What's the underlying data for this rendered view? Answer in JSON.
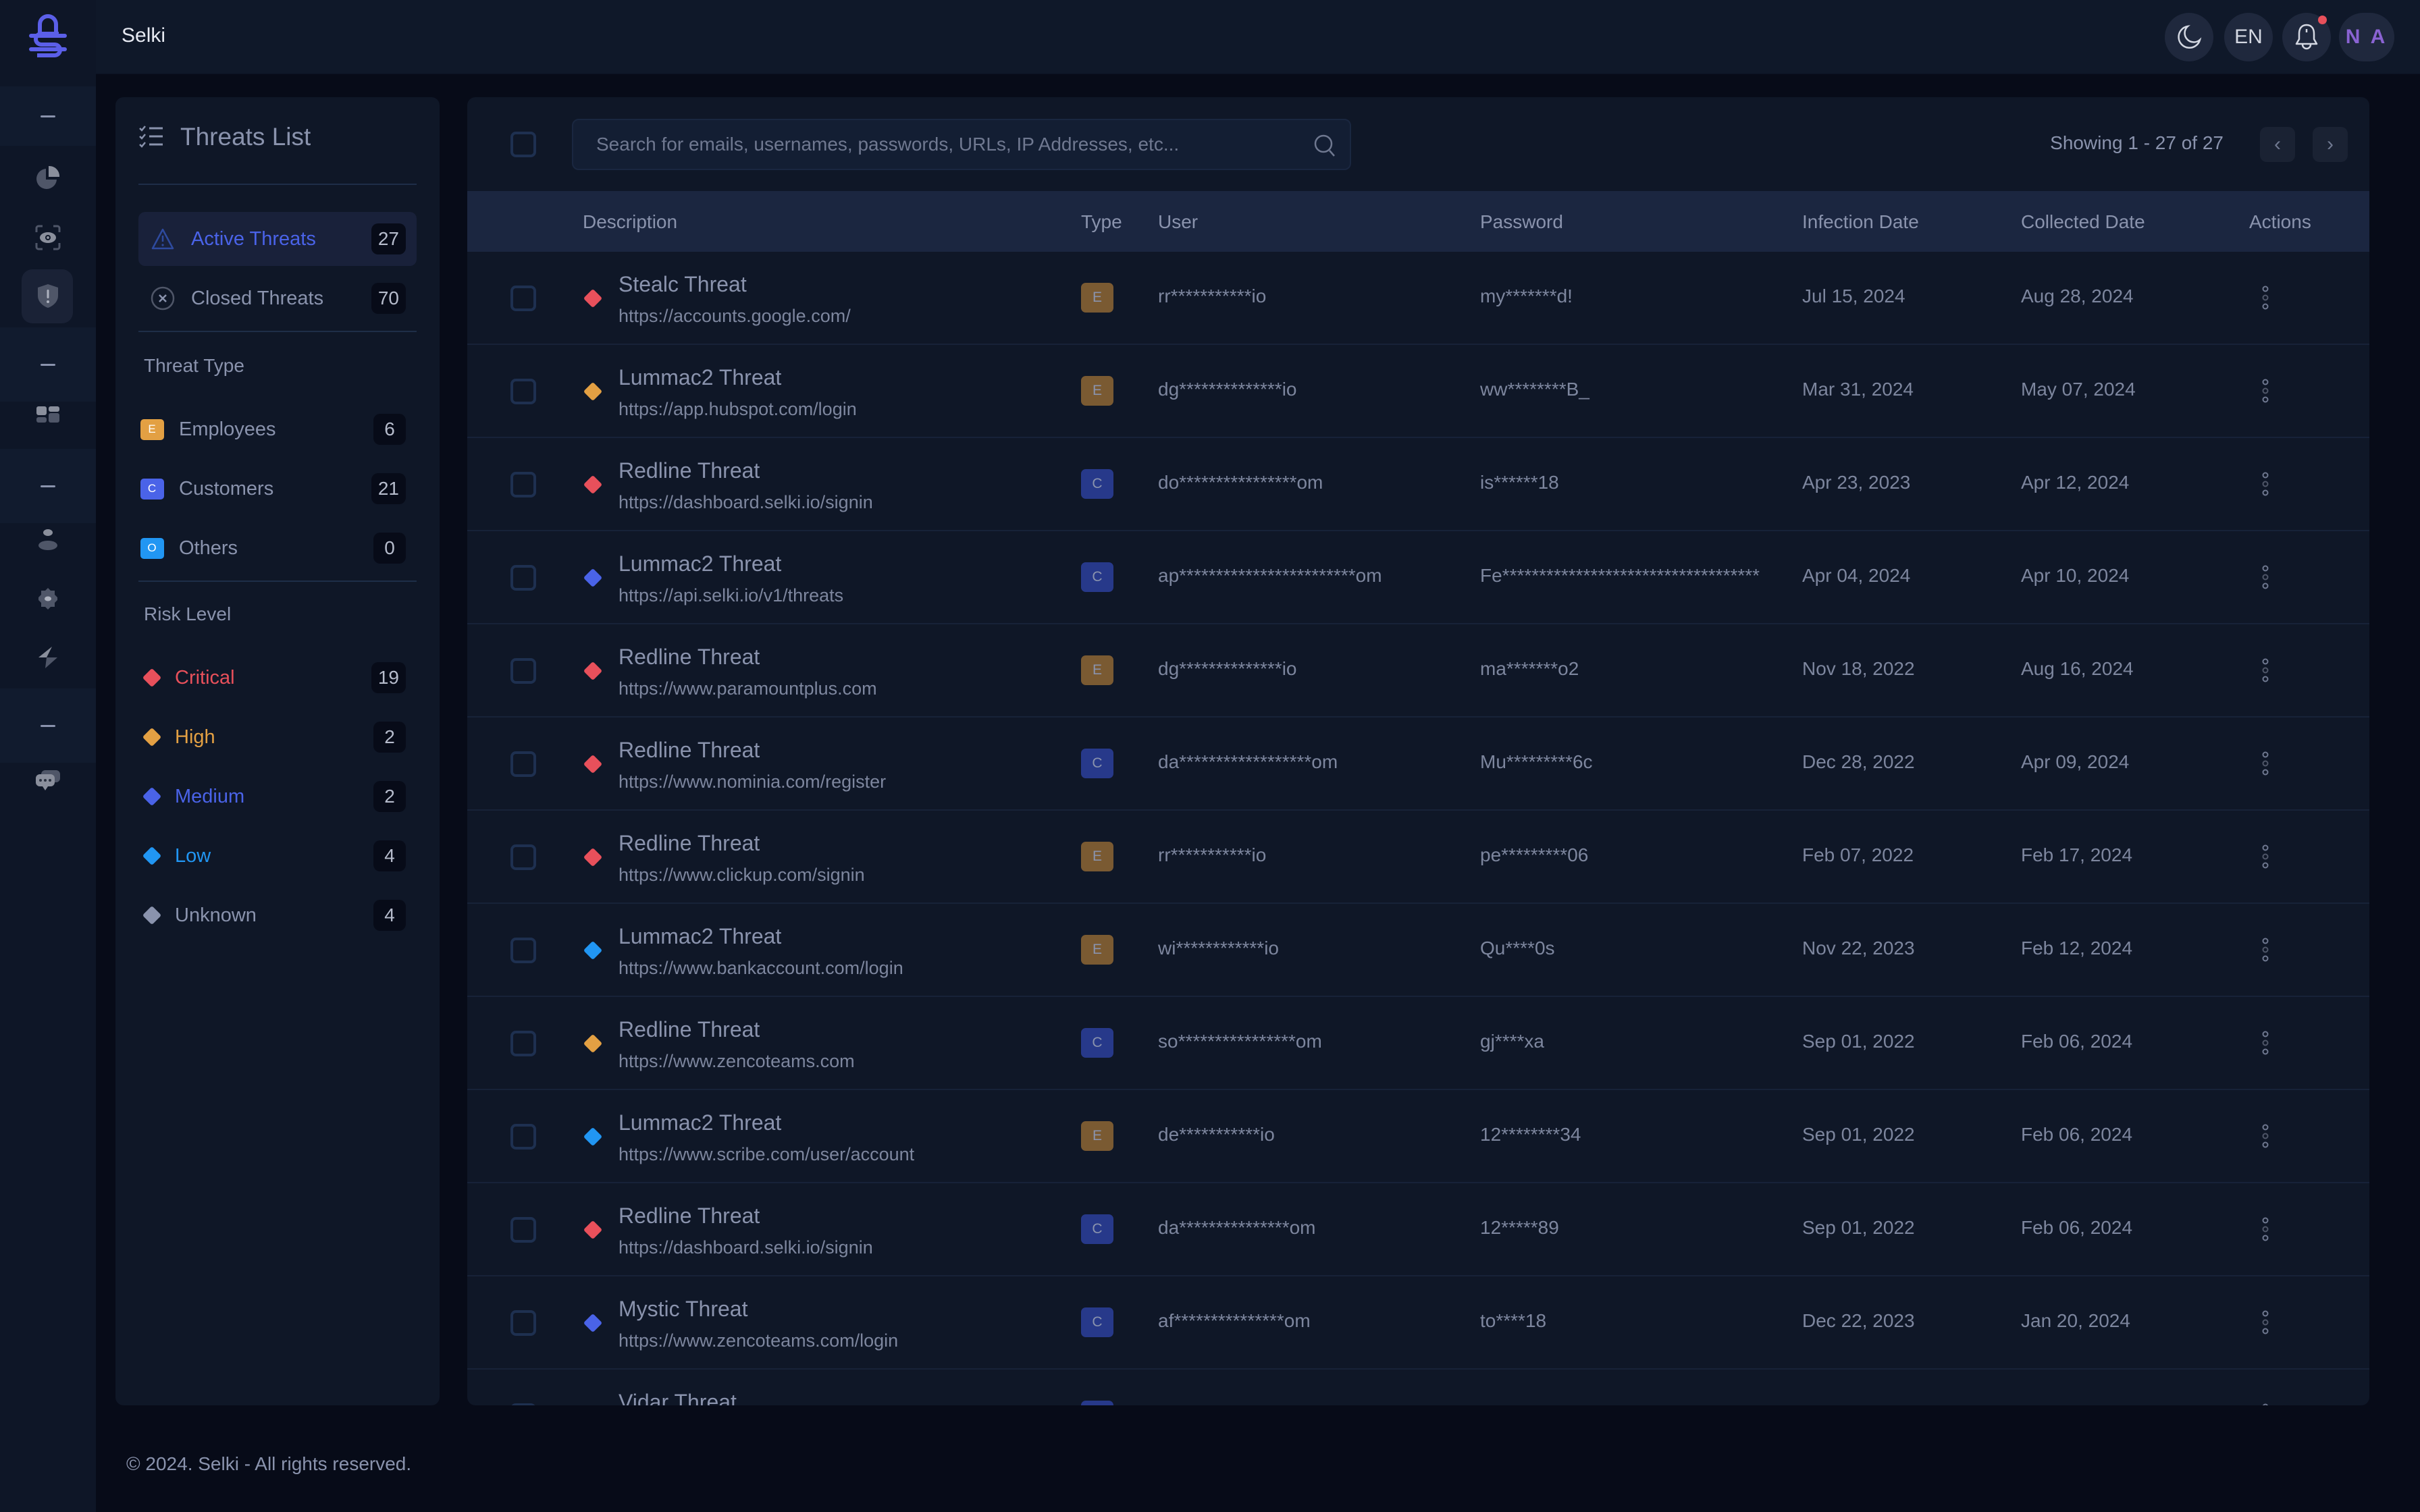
{
  "app": {
    "title": "Selki"
  },
  "header": {
    "theme_icon": "moon-icon",
    "language": "EN",
    "notification_icon": "bell-icon",
    "avatar_initials": "N A",
    "notification_dot_color": "#e8505b"
  },
  "rail": {
    "items": [
      {
        "name": "collapse",
        "icon": "dash-icon"
      },
      {
        "name": "dashboard",
        "icon": "pie-chart-icon"
      },
      {
        "name": "monitoring",
        "icon": "eye-scan-icon"
      },
      {
        "name": "threats",
        "icon": "shield-alert-icon",
        "active": true
      },
      {
        "name": "separator-1",
        "icon": "dash-icon"
      },
      {
        "name": "apps",
        "icon": "grid-icon"
      },
      {
        "name": "separator-2",
        "icon": "dash-icon"
      },
      {
        "name": "users",
        "icon": "user-icon"
      },
      {
        "name": "settings",
        "icon": "gear-icon"
      },
      {
        "name": "integrations",
        "icon": "bolt-icon"
      },
      {
        "name": "separator-3",
        "icon": "dash-icon"
      },
      {
        "name": "support",
        "icon": "chat-icon"
      }
    ]
  },
  "threats_panel": {
    "title": "Threats List",
    "status": [
      {
        "label": "Active Threats",
        "count": "27",
        "active": true,
        "color": "#4a63e8"
      },
      {
        "label": "Closed Threats",
        "count": "70",
        "active": false
      }
    ],
    "threat_type_heading": "Threat Type",
    "types": [
      {
        "letter": "E",
        "label": "Employees",
        "count": "6",
        "color": "#e3a043"
      },
      {
        "letter": "C",
        "label": "Customers",
        "count": "21",
        "color": "#4a63e8"
      },
      {
        "letter": "O",
        "label": "Others",
        "count": "0",
        "color": "#2196f3"
      }
    ],
    "risk_heading": "Risk Level",
    "risks": [
      {
        "label": "Critical",
        "count": "19",
        "color": "#e8505b"
      },
      {
        "label": "High",
        "count": "2",
        "color": "#e3a043"
      },
      {
        "label": "Medium",
        "count": "2",
        "color": "#4a63e8"
      },
      {
        "label": "Low",
        "count": "4",
        "color": "#2196f3"
      },
      {
        "label": "Unknown",
        "count": "4",
        "color": "#8a93ad"
      }
    ]
  },
  "table": {
    "search_placeholder": "Search for emails, usernames, passwords, URLs, IP Addresses, etc...",
    "showing": "Showing 1 - 27 of 27",
    "columns": [
      "Description",
      "Type",
      "User",
      "Password",
      "Infection Date",
      "Collected Date",
      "Actions"
    ],
    "type_colors": {
      "E": "#7a5a32",
      "C": "#27398a"
    },
    "risk_colors": {
      "critical": "#e8505b",
      "high": "#e3a043",
      "medium": "#4a63e8",
      "low": "#2196f3"
    },
    "rows": [
      {
        "name": "Stealc Threat",
        "url": "https://accounts.google.com/",
        "risk": "critical",
        "type": "E",
        "user": "rr***********io",
        "password": "my*******d!",
        "infection": "Jul 15, 2024",
        "collected": "Aug 28, 2024"
      },
      {
        "name": "Lummac2 Threat",
        "url": "https://app.hubspot.com/login",
        "risk": "high",
        "type": "E",
        "user": "dg**************io",
        "password": "ww********B_",
        "infection": "Mar 31, 2024",
        "collected": "May 07, 2024"
      },
      {
        "name": "Redline Threat",
        "url": "https://dashboard.selki.io/signin",
        "risk": "critical",
        "type": "C",
        "user": "do****************om",
        "password": "is******18",
        "infection": "Apr 23, 2023",
        "collected": "Apr 12, 2024"
      },
      {
        "name": "Lummac2 Threat",
        "url": "https://api.selki.io/v1/threats",
        "risk": "medium",
        "type": "C",
        "user": "ap************************om",
        "password": "Fe***********************************",
        "infection": "Apr 04, 2024",
        "collected": "Apr 10, 2024"
      },
      {
        "name": "Redline Threat",
        "url": "https://www.paramountplus.com",
        "risk": "critical",
        "type": "E",
        "user": "dg**************io",
        "password": "ma*******o2",
        "infection": "Nov 18, 2022",
        "collected": "Aug 16, 2024"
      },
      {
        "name": "Redline Threat",
        "url": "https://www.nominia.com/register",
        "risk": "critical",
        "type": "C",
        "user": "da******************om",
        "password": "Mu*********6c",
        "infection": "Dec 28, 2022",
        "collected": "Apr 09, 2024"
      },
      {
        "name": "Redline Threat",
        "url": "https://www.clickup.com/signin",
        "risk": "critical",
        "type": "E",
        "user": "rr***********io",
        "password": "pe*********06",
        "infection": "Feb 07, 2022",
        "collected": "Feb 17, 2024"
      },
      {
        "name": "Lummac2 Threat",
        "url": "https://www.bankaccount.com/login",
        "risk": "low",
        "type": "E",
        "user": "wi************io",
        "password": "Qu****0s",
        "infection": "Nov 22, 2023",
        "collected": "Feb 12, 2024"
      },
      {
        "name": "Redline Threat",
        "url": "https://www.zencoteams.com",
        "risk": "high",
        "type": "C",
        "user": "so****************om",
        "password": "gj****xa",
        "infection": "Sep 01, 2022",
        "collected": "Feb 06, 2024"
      },
      {
        "name": "Lummac2 Threat",
        "url": "https://www.scribe.com/user/account",
        "risk": "low",
        "type": "E",
        "user": "de***********io",
        "password": "12********34",
        "infection": "Sep 01, 2022",
        "collected": "Feb 06, 2024"
      },
      {
        "name": "Redline Threat",
        "url": "https://dashboard.selki.io/signin",
        "risk": "critical",
        "type": "C",
        "user": "da***************om",
        "password": "12*****89",
        "infection": "Sep 01, 2022",
        "collected": "Feb 06, 2024"
      },
      {
        "name": "Mystic Threat",
        "url": "https://www.zencoteams.com/login",
        "risk": "medium",
        "type": "C",
        "user": "af***************om",
        "password": "to****18",
        "infection": "Dec 22, 2023",
        "collected": "Jan 20, 2024"
      },
      {
        "name": "Vidar Threat",
        "url": "",
        "risk": "medium",
        "type": "C",
        "user": "",
        "password": "",
        "infection": "",
        "collected": ""
      }
    ]
  },
  "footer": {
    "text": "© 2024. Selki - All rights reserved."
  }
}
